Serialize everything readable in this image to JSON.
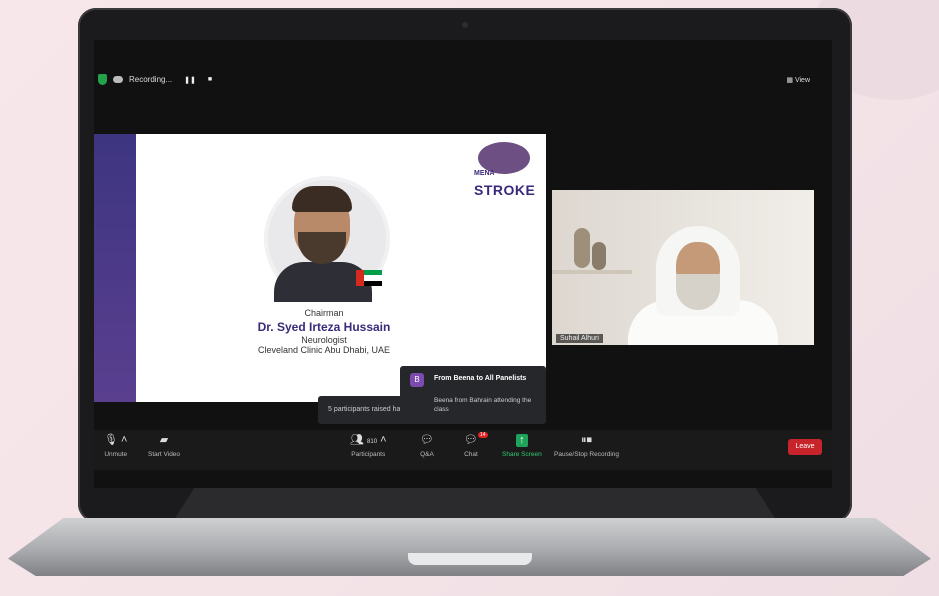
{
  "topbar": {
    "recording_label": "Recording...",
    "view_label": "View"
  },
  "slide": {
    "brand_mena": "MENA",
    "brand_stroke": "STROKE",
    "title": "Chairman",
    "name": "Dr. Syed Irteza Hussain",
    "role": "Neurologist",
    "institution": "Cleveland Clinic Abu Dhabi, UAE"
  },
  "video": {
    "participant_name": "Suhail Alhuri"
  },
  "toast": {
    "avatar_letter": "B",
    "title": "From Beena to All Panelists",
    "message": "Beena from Bahrain attending the class",
    "raised_text": "5 participants raised hands"
  },
  "toolbar": {
    "unmute": "Unmute",
    "start_video": "Start Video",
    "participants": "Participants",
    "participants_count": "810",
    "qa": "Q&A",
    "chat": "Chat",
    "chat_badge": "14",
    "share_screen": "Share Screen",
    "pause_stop": "Pause/Stop Recording",
    "leave": "Leave"
  },
  "colors": {
    "leave": "#c8242b",
    "share_green": "#1fa35a",
    "brand_purple": "#3b2a7a"
  }
}
